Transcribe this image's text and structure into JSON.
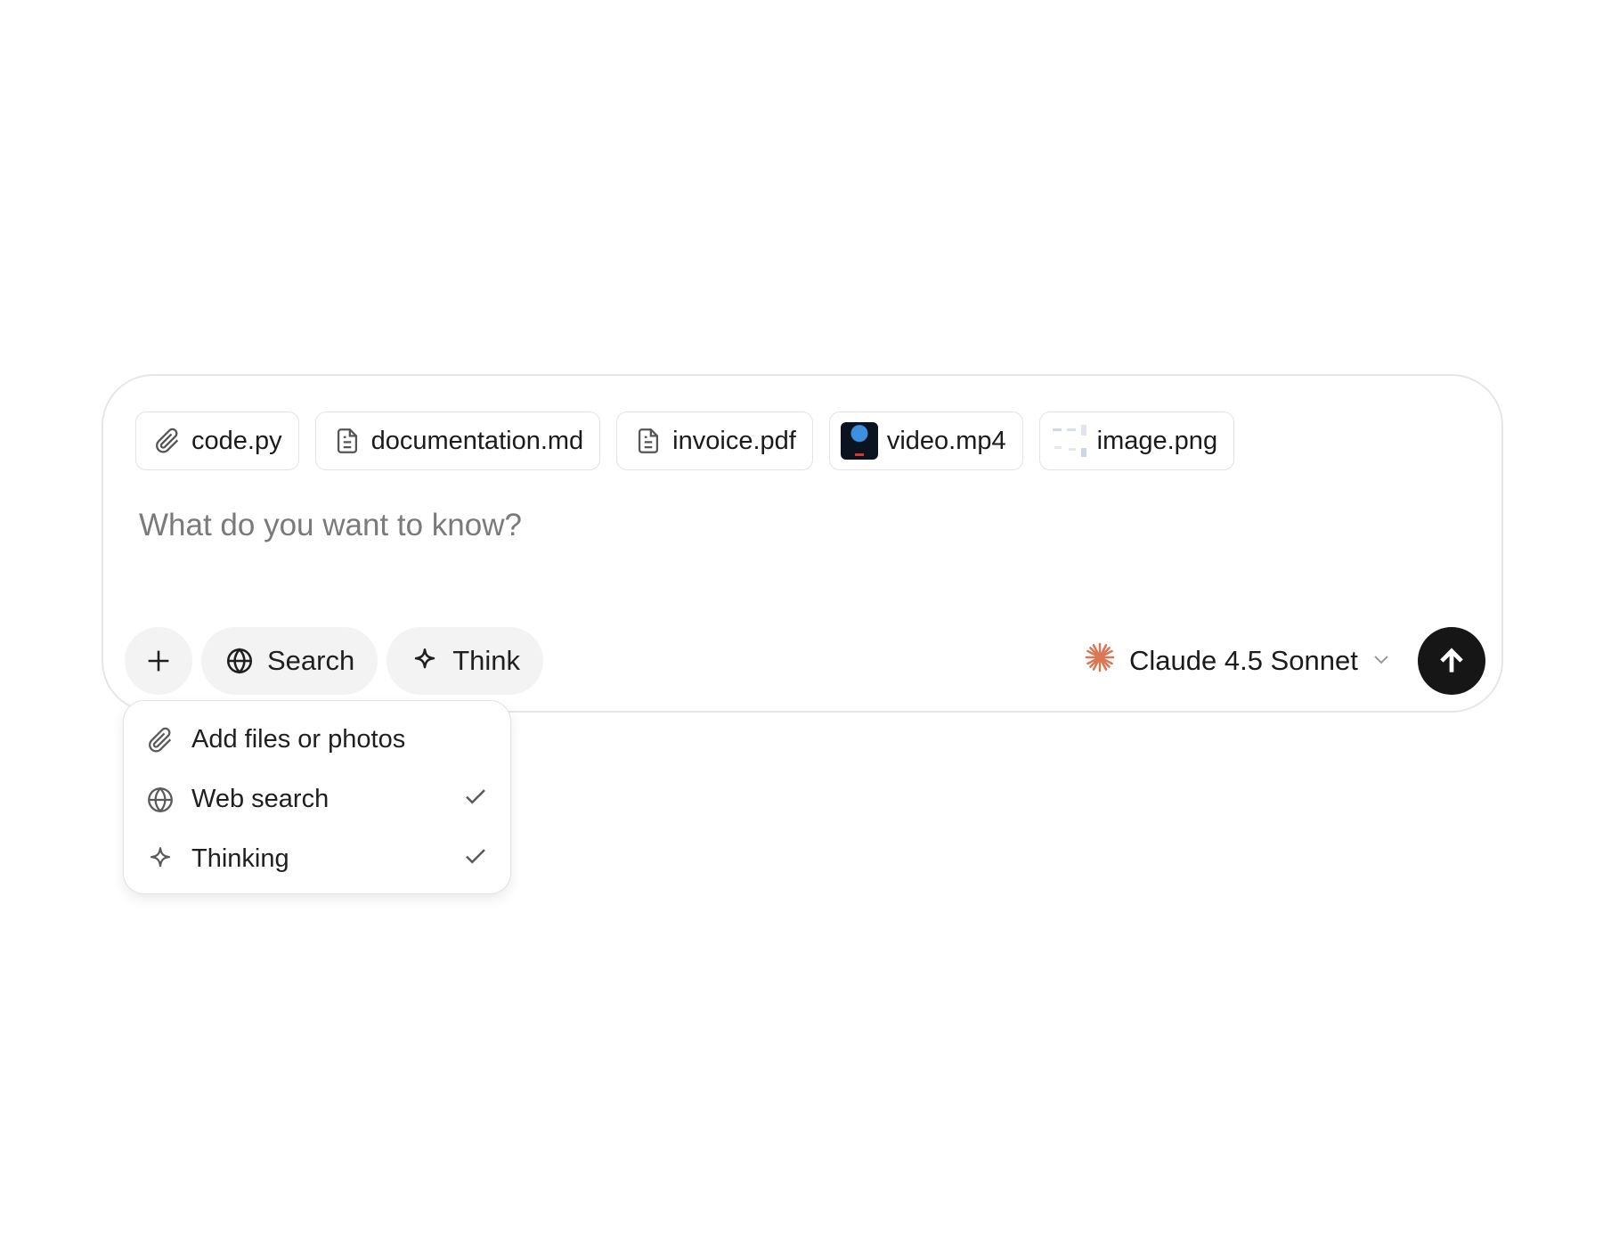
{
  "attachments": [
    {
      "name": "code.py",
      "icon": "paperclip-icon"
    },
    {
      "name": "documentation.md",
      "icon": "file-icon"
    },
    {
      "name": "invoice.pdf",
      "icon": "file-icon"
    },
    {
      "name": "video.mp4",
      "icon": "video-thumbnail"
    },
    {
      "name": "image.png",
      "icon": "image-thumbnail"
    }
  ],
  "prompt": {
    "placeholder": "What do you want to know?",
    "value": ""
  },
  "toolbar": {
    "add_icon": "plus-icon",
    "search_label": "Search",
    "think_label": "Think"
  },
  "model": {
    "name": "Claude 4.5 Sonnet",
    "icon": "claude-spark-icon",
    "accent": "#d97757"
  },
  "send": {
    "icon": "arrow-up-icon",
    "background": "#161616"
  },
  "menu": {
    "items": [
      {
        "label": "Add files or photos",
        "icon": "paperclip-icon",
        "checked": false
      },
      {
        "label": "Web search",
        "icon": "globe-icon",
        "checked": true
      },
      {
        "label": "Thinking",
        "icon": "sparkle-icon",
        "checked": true
      }
    ]
  }
}
